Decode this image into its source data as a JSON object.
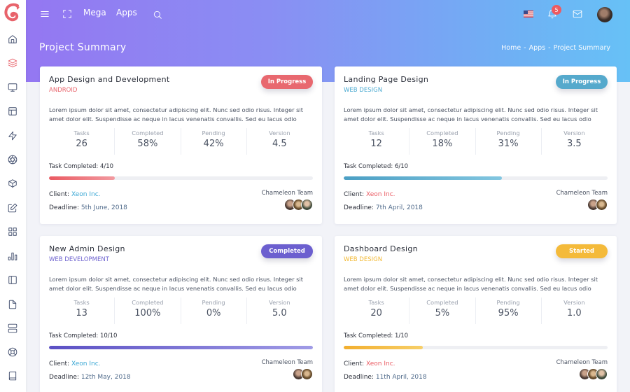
{
  "topbar": {
    "links": [
      "Mega",
      "Apps"
    ],
    "notification_count": "5",
    "icons": [
      "menu-icon",
      "fullscreen-icon",
      "search-icon",
      "us-flag-icon",
      "bell-icon",
      "mail-icon",
      "user-avatar"
    ]
  },
  "page": {
    "title": "Project Summary",
    "breadcrumb": [
      "Home",
      "Apps",
      "Project Summary"
    ],
    "breadcrumb_separator": "-"
  },
  "sidebar": {
    "items": [
      "home-icon",
      "layers-icon",
      "monitor-icon",
      "layout-icon",
      "zap-icon",
      "aperture-icon",
      "box-icon",
      "edit-icon",
      "grid-icon",
      "bar-chart-icon",
      "sidebar-icon",
      "file-icon",
      "server-icon",
      "life-buoy-icon",
      "book-icon"
    ],
    "active": "layers-icon"
  },
  "labels": {
    "tasks": "Tasks",
    "completed": "Completed",
    "pending": "Pending",
    "version": "Version",
    "client": "Client:",
    "deadline": "Deadline:",
    "team": "Chameleon Team"
  },
  "projects": [
    {
      "title": "App Design and Development",
      "category": "ANDROID",
      "category_color": "#e8636b",
      "status": "In Progress",
      "status_color": "#e8686f",
      "description": "Lorem ipsum dolor sit amet, consectetur adipiscing elit. Nunc sed odio risus. Integer sit amet dolor elit. Suspendisse ac neque in lacus venenatis convallis. Sed eu lacus odio",
      "tasks": "26",
      "completed": "58%",
      "pending": "42%",
      "version": "4.5",
      "task_completed": "Task Completed: 4/10",
      "progress": 0.25,
      "progress_gradient": [
        "#ea5a62",
        "#f29aa0"
      ],
      "client": "Xeon Inc.",
      "client_color": "#3aa7d4",
      "deadline": "5th June, 2018",
      "team_size": 3
    },
    {
      "title": "Landing Page Design",
      "category": "WEB DESIGN",
      "category_color": "#4aa9d0",
      "status": "In Progress",
      "status_color": "#55a9cc",
      "description": "Lorem ipsum dolor sit amet, consectetur adipiscing elit. Nunc sed odio risus. Integer sit amet dolor elit. Suspendisse ac neque in lacus venenatis convallis. Sed eu lacus odio",
      "tasks": "12",
      "completed": "18%",
      "pending": "31%",
      "version": "3.5",
      "task_completed": "Task Completed: 6/10",
      "progress": 0.6,
      "progress_gradient": [
        "#4b9fc4",
        "#82c6e0"
      ],
      "client": "Xeon Inc.",
      "client_color": "#ea5a62",
      "deadline": "7th April, 2018",
      "team_size": 2
    },
    {
      "title": "New Admin Design",
      "category": "WEB DEVELOPMENT",
      "category_color": "#6e63cf",
      "status": "Completed",
      "status_color": "#6c5fcf",
      "description": "Lorem ipsum dolor sit amet, consectetur adipiscing elit. Nunc sed odio risus. Integer sit amet dolor elit. Suspendisse ac neque in lacus venenatis convallis. Sed eu lacus odio",
      "tasks": "13",
      "completed": "100%",
      "pending": "0%",
      "version": "5.0",
      "task_completed": "Task Completed: 10/10",
      "progress": 1.0,
      "progress_gradient": [
        "#5b50c4",
        "#a09be6"
      ],
      "client": "Xeon Inc.",
      "client_color": "#3aa7d4",
      "deadline": "12th May, 2018",
      "team_size": 2
    },
    {
      "title": "Dashboard Design",
      "category": "WEB DESIGN",
      "category_color": "#f2b934",
      "status": "Started",
      "status_color": "#f4ba3a",
      "description": "Lorem ipsum dolor sit amet, consectetur adipiscing elit. Nunc sed odio risus. Integer sit amet dolor elit. Suspendisse ac neque in lacus venenatis convallis. Sed eu lacus odio",
      "tasks": "20",
      "completed": "5%",
      "pending": "95%",
      "version": "1.0",
      "task_completed": "Task Completed: 1/10",
      "progress": 0.3,
      "progress_gradient": [
        "#f2ae2e",
        "#f7cf68"
      ],
      "client": "Xeon Inc.",
      "client_color": "#ea5a62",
      "deadline": "11th April, 2018",
      "team_size": 3
    }
  ]
}
